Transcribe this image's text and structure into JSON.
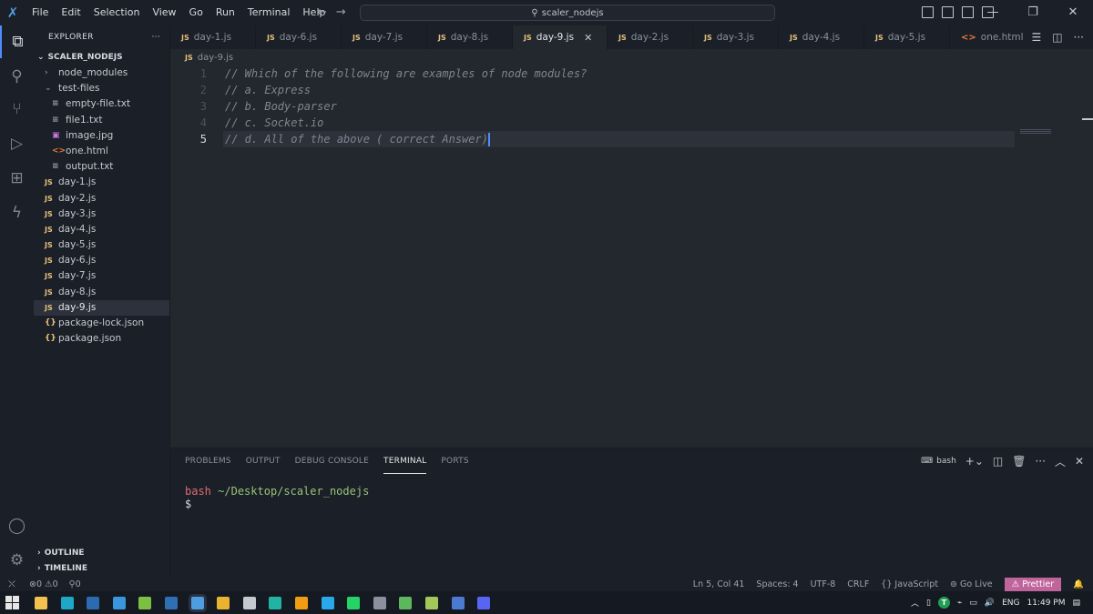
{
  "menu": [
    "File",
    "Edit",
    "Selection",
    "View",
    "Go",
    "Run",
    "Terminal",
    "Help"
  ],
  "search": {
    "label": "scaler_nodejs"
  },
  "explorer": {
    "title": "EXPLORER",
    "more": "···",
    "root": "SCALER_NODEJS",
    "items": [
      {
        "label": "node_modules",
        "icon": "›",
        "kind": "chev",
        "indent": 12
      },
      {
        "label": "test-files",
        "icon": "⌄",
        "kind": "chev",
        "indent": 12
      },
      {
        "label": "empty-file.txt",
        "icon": "≡",
        "kind": "txt",
        "indent": 20
      },
      {
        "label": "file1.txt",
        "icon": "≡",
        "kind": "txt",
        "indent": 20
      },
      {
        "label": "image.jpg",
        "icon": "▣",
        "kind": "img",
        "indent": 20
      },
      {
        "label": "one.html",
        "icon": "<>",
        "kind": "html",
        "indent": 20
      },
      {
        "label": "output.txt",
        "icon": "≡",
        "kind": "txt",
        "indent": 20
      },
      {
        "label": "day-1.js",
        "icon": "JS",
        "kind": "js",
        "indent": 12
      },
      {
        "label": "day-2.js",
        "icon": "JS",
        "kind": "js",
        "indent": 12
      },
      {
        "label": "day-3.js",
        "icon": "JS",
        "kind": "js",
        "indent": 12
      },
      {
        "label": "day-4.js",
        "icon": "JS",
        "kind": "js",
        "indent": 12
      },
      {
        "label": "day-5.js",
        "icon": "JS",
        "kind": "js",
        "indent": 12
      },
      {
        "label": "day-6.js",
        "icon": "JS",
        "kind": "js",
        "indent": 12
      },
      {
        "label": "day-7.js",
        "icon": "JS",
        "kind": "js",
        "indent": 12
      },
      {
        "label": "day-8.js",
        "icon": "JS",
        "kind": "js",
        "indent": 12
      },
      {
        "label": "day-9.js",
        "icon": "JS",
        "kind": "js",
        "indent": 12,
        "selected": true
      },
      {
        "label": "package-lock.json",
        "icon": "{}",
        "kind": "json",
        "indent": 12
      },
      {
        "label": "package.json",
        "icon": "{}",
        "kind": "json",
        "indent": 12
      }
    ],
    "outline": "OUTLINE",
    "timeline": "TIMELINE"
  },
  "tabs": [
    {
      "label": "day-1.js",
      "icon": "JS"
    },
    {
      "label": "day-6.js",
      "icon": "JS"
    },
    {
      "label": "day-7.js",
      "icon": "JS"
    },
    {
      "label": "day-8.js",
      "icon": "JS"
    },
    {
      "label": "day-9.js",
      "icon": "JS",
      "active": true
    },
    {
      "label": "day-2.js",
      "icon": "JS"
    },
    {
      "label": "day-3.js",
      "icon": "JS"
    },
    {
      "label": "day-4.js",
      "icon": "JS"
    },
    {
      "label": "day-5.js",
      "icon": "JS"
    },
    {
      "label": "one.html",
      "icon": "<>",
      "kind": "html"
    }
  ],
  "breadcrumb": {
    "icon": "JS",
    "file": "day-9.js"
  },
  "editor": {
    "lines": [
      {
        "num": "1",
        "text": "// Which of the following are examples of node modules?"
      },
      {
        "num": "2",
        "text": "// a. Express"
      },
      {
        "num": "3",
        "text": "// b. Body-parser"
      },
      {
        "num": "4",
        "text": "// c. Socket.io"
      },
      {
        "num": "5",
        "text": "// d. All of the above ( correct Answer)",
        "current": true
      }
    ]
  },
  "panel": {
    "tabs": [
      "PROBLEMS",
      "OUTPUT",
      "DEBUG CONSOLE",
      "TERMINAL",
      "PORTS"
    ],
    "active_tab": "TERMINAL",
    "shell": "bash",
    "terminal": {
      "user": "bash",
      "path": "~/Desktop/scaler_nodejs",
      "prompt": "$"
    }
  },
  "status": {
    "errors": "0",
    "warnings": "0",
    "ports": "0",
    "position": "Ln 5, Col 41",
    "spaces": "Spaces: 4",
    "encoding": "UTF-8",
    "eol": "CRLF",
    "language": "JavaScript",
    "golive": "Go Live",
    "prettier": "Prettier"
  },
  "taskbar": {
    "lang": "ENG",
    "time": "11:49 PM",
    "badge": "T",
    "apps": [
      {
        "name": "file-explorer-app-icon",
        "color": "#f2c14e"
      },
      {
        "name": "edge-browser-icon",
        "color": "#1ea7c7"
      },
      {
        "name": "terminal-app-icon",
        "color": "#2b6cb0"
      },
      {
        "name": "vscode-app-icon",
        "color": "#3a96dd"
      },
      {
        "name": "notepad-app-icon",
        "color": "#7bc043"
      },
      {
        "name": "powershell-app-icon",
        "color": "#2f6fb3"
      },
      {
        "name": "vscode-insiders-app-icon",
        "color": "#4d9de0"
      },
      {
        "name": "chrome-browser-icon",
        "color": "#e8b430"
      },
      {
        "name": "media-app-icon",
        "color": "#c5c8ce"
      },
      {
        "name": "app-circle-icon",
        "color": "#23b3a5"
      },
      {
        "name": "sublime-app-icon",
        "color": "#f39c12"
      },
      {
        "name": "telegram-app-icon",
        "color": "#29a9eb"
      },
      {
        "name": "whatsapp-app-icon",
        "color": "#25d366"
      },
      {
        "name": "app-square-icon",
        "color": "#8b919c"
      },
      {
        "name": "app-green-icon",
        "color": "#5cb85c"
      },
      {
        "name": "app-terminal-icon",
        "color": "#a3c85a"
      },
      {
        "name": "app-blue-icon",
        "color": "#4a7bd0"
      },
      {
        "name": "discord-app-icon",
        "color": "#5865f2"
      }
    ]
  },
  "colors": {
    "accent": "#528bff",
    "prettier": "#c0649c",
    "editor_bg": "#23272e",
    "sidebar_bg": "#1b1f27"
  }
}
